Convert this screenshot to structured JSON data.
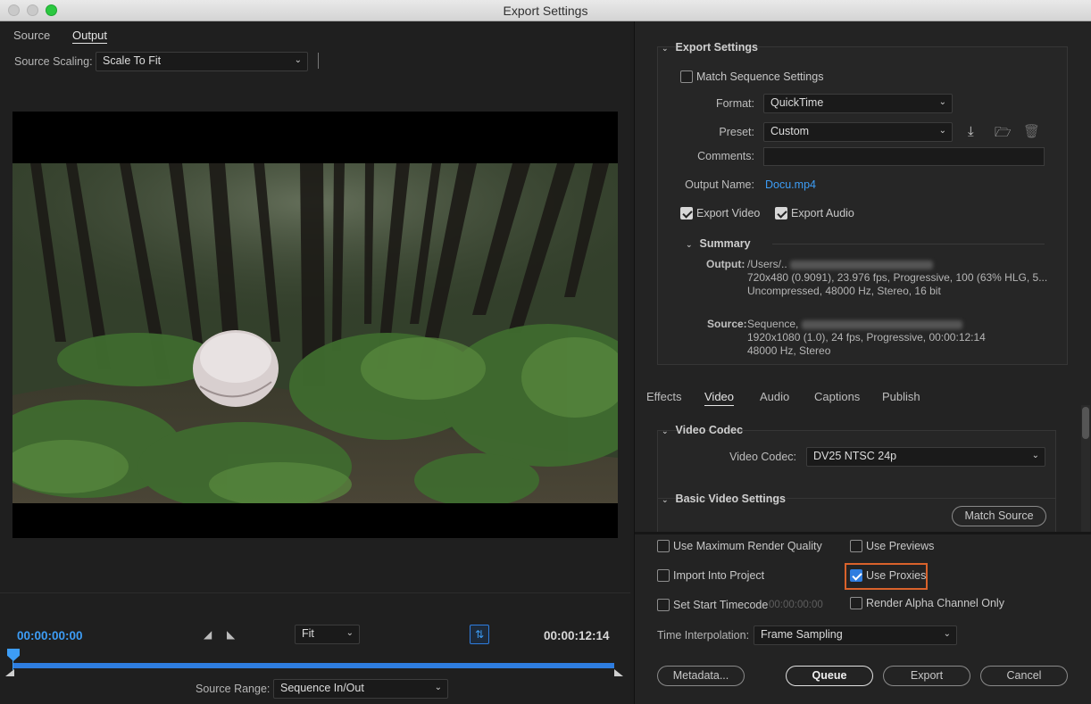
{
  "window": {
    "title": "Export Settings"
  },
  "left": {
    "tabs": {
      "source": "Source",
      "output": "Output"
    },
    "source_scaling_label": "Source Scaling:",
    "source_scaling_value": "Scale To Fit",
    "timecode_start": "00:00:00:00",
    "timecode_end": "00:00:12:14",
    "zoom_value": "Fit",
    "source_range_label": "Source Range:",
    "source_range_value": "Sequence In/Out"
  },
  "export_settings": {
    "heading": "Export Settings",
    "match_sequence": "Match Sequence Settings",
    "format_label": "Format:",
    "format_value": "QuickTime",
    "preset_label": "Preset:",
    "preset_value": "Custom",
    "comments_label": "Comments:",
    "comments_value": "",
    "output_name_label": "Output Name:",
    "output_name_value": "Docu.mp4",
    "export_video": "Export Video",
    "export_audio": "Export Audio"
  },
  "summary": {
    "heading": "Summary",
    "output_label": "Output:",
    "output_line1": "/Users/..",
    "output_line2": "720x480 (0.9091), 23.976 fps, Progressive, 100 (63% HLG, 5...",
    "output_line3": "Uncompressed, 48000 Hz, Stereo, 16 bit",
    "source_label": "Source:",
    "source_line1": "Sequence,",
    "source_line2": "1920x1080 (1.0), 24 fps, Progressive, 00:00:12:14",
    "source_line3": "48000 Hz, Stereo"
  },
  "subtabs": [
    "Effects",
    "Video",
    "Audio",
    "Captions",
    "Publish"
  ],
  "video_codec": {
    "heading": "Video Codec",
    "label": "Video Codec:",
    "value": "DV25 NTSC 24p"
  },
  "basic_video": {
    "heading": "Basic Video Settings",
    "match_source": "Match Source"
  },
  "options": {
    "max_render_quality": "Use Maximum Render Quality",
    "use_previews": "Use Previews",
    "import_into_project": "Import Into Project",
    "use_proxies": "Use Proxies",
    "set_start_timecode": "Set Start Timecode",
    "start_timecode_value": "00:00:00:00",
    "render_alpha": "Render Alpha Channel Only",
    "time_interp_label": "Time Interpolation:",
    "time_interp_value": "Frame Sampling"
  },
  "buttons": {
    "metadata": "Metadata...",
    "queue": "Queue",
    "export": "Export",
    "cancel": "Cancel"
  },
  "colors": {
    "accent_blue": "#2e8be0",
    "highlight_orange": "#d9622b",
    "link_blue": "#3d9df6"
  }
}
